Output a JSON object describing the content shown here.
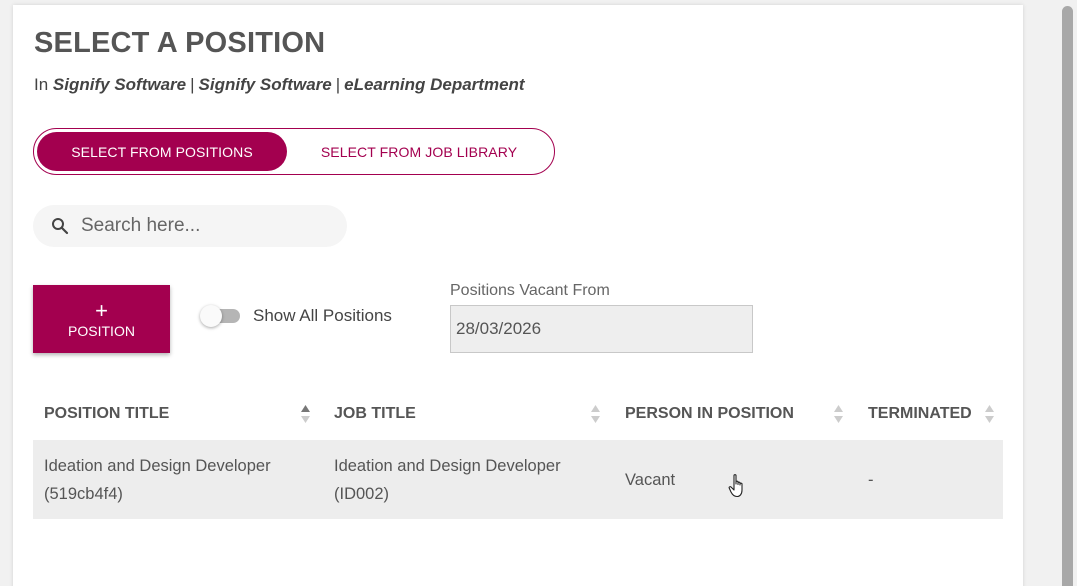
{
  "header": {
    "title": "SELECT A POSITION",
    "in_prefix": "In",
    "crumb_1": "Signify Software",
    "crumb_2": "Signify Software",
    "crumb_3": "eLearning Department",
    "separator": "|"
  },
  "tabs": [
    {
      "label": "SELECT FROM POSITIONS",
      "active": true
    },
    {
      "label": "SELECT FROM JOB LIBRARY",
      "active": false
    }
  ],
  "search": {
    "placeholder": "Search here...",
    "icon": "search-icon"
  },
  "add_button": {
    "plus": "+",
    "label": "POSITION"
  },
  "toggle": {
    "label": "Show All Positions",
    "checked": false
  },
  "vacant_from": {
    "label": "Positions Vacant From",
    "value": "28/03/2026"
  },
  "table": {
    "columns": [
      "POSITION TITLE",
      "JOB TITLE",
      "PERSON IN POSITION",
      "TERMINATED"
    ],
    "rows": [
      {
        "position_title": "Ideation and Design Developer",
        "position_code": "(519cb4f4)",
        "job_title": "Ideation and Design Developer",
        "job_code": "(ID002)",
        "person": "Vacant",
        "terminated": "-"
      }
    ]
  },
  "colors": {
    "accent": "#a3004f",
    "row_bg": "#ededed",
    "text": "#555555"
  }
}
